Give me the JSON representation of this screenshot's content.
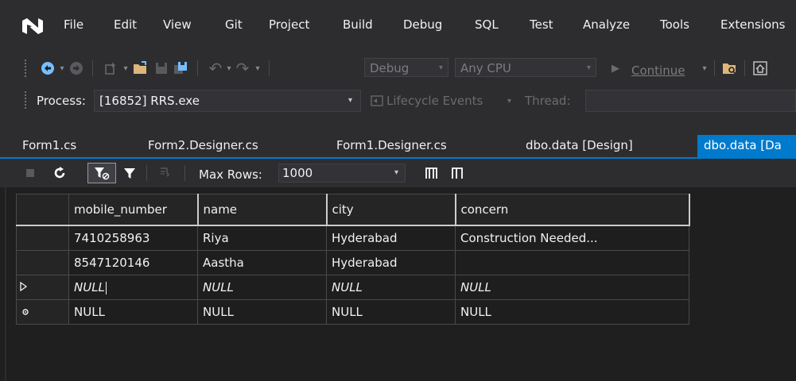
{
  "menu": {
    "items": [
      "File",
      "Edit",
      "View",
      "Git",
      "Project",
      "Build",
      "Debug",
      "SQL",
      "Test",
      "Analyze",
      "Tools",
      "Extensions"
    ]
  },
  "toolbar": {
    "config_value": "Debug",
    "platform_value": "Any CPU",
    "continue_label": "Continue"
  },
  "debug_location": {
    "process_label": "Process:",
    "process_value": "[16852] RRS.exe",
    "lifecycle_label": "Lifecycle Events",
    "thread_label": "Thread:"
  },
  "tabs": [
    "Form1.cs",
    "Form2.Designer.cs",
    "Form1.Designer.cs",
    "dbo.data [Design]",
    "dbo.data [Da"
  ],
  "designer_toolbar": {
    "max_rows_label": "Max Rows:",
    "max_rows_value": "1000"
  },
  "grid": {
    "columns": [
      "mobile_number",
      "name",
      "city",
      "concern"
    ],
    "rows": [
      {
        "cells": [
          "7410258963",
          "Riya",
          "Hyderabad",
          "Construction Needed..."
        ]
      },
      {
        "cells": [
          "8547120146",
          "Aastha",
          "Hyderabad",
          ""
        ]
      },
      {
        "cells": [
          "NULL",
          "NULL",
          "NULL",
          "NULL"
        ]
      },
      {
        "cells": [
          "NULL",
          "NULL",
          "NULL",
          "NULL"
        ]
      }
    ]
  },
  "colors": {
    "accent": "#007acc",
    "chrome_bg": "#2d2d30",
    "editor_bg": "#1e1e1e"
  }
}
